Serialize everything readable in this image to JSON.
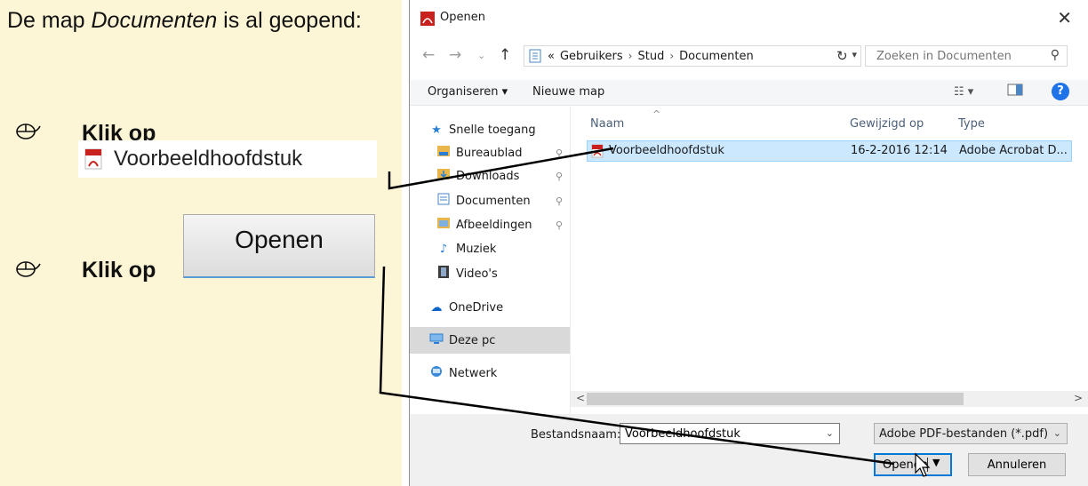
{
  "instructions": {
    "intro_pre": "De map ",
    "intro_em": "Documenten",
    "intro_post": " is al geopend:",
    "step1_label": "Klik op",
    "step1_sample": "Voorbeeldhoofdstuk",
    "step2_label": "Klik op",
    "step2_sample": "Openen"
  },
  "dialog": {
    "title": "Openen",
    "address": {
      "overflow": "«",
      "crumbs": [
        "Gebruikers",
        "Stud",
        "Documenten"
      ]
    },
    "search_placeholder": "Zoeken in Documenten",
    "toolbar": {
      "organize": "Organiseren ▾",
      "new_folder": "Nieuwe map"
    },
    "nav": {
      "quick_access": "Snelle toegang",
      "items": [
        "Bureaublad",
        "Downloads",
        "Documenten",
        "Afbeeldingen",
        "Muziek",
        "Video's"
      ],
      "onedrive": "OneDrive",
      "this_pc": "Deze pc",
      "network": "Netwerk"
    },
    "columns": {
      "name": "Naam",
      "modified": "Gewijzigd op",
      "type": "Type"
    },
    "files": [
      {
        "name": "Voorbeeldhoofdstuk",
        "modified": "16-2-2016 12:14",
        "type": "Adobe Acrobat D..."
      }
    ],
    "filename_label": "Bestandsnaam:",
    "filename_value": "Voorbeeldhoofdstuk",
    "filetype": "Adobe PDF-bestanden (*.pdf)",
    "open_label": "Openen",
    "cancel_label": "Annuleren"
  },
  "icons": {
    "pdf": "pdf-file-icon",
    "mouse": "mouse-icon",
    "star": "star-icon",
    "folder": "folder-icon",
    "cloud": "cloud-icon",
    "pc": "pc-icon",
    "network": "network-icon"
  },
  "colors": {
    "panel_bg": "#fdf6d6",
    "selection": "#cce8ff",
    "accent": "#0078d7",
    "pdf_red": "#c9211e"
  }
}
